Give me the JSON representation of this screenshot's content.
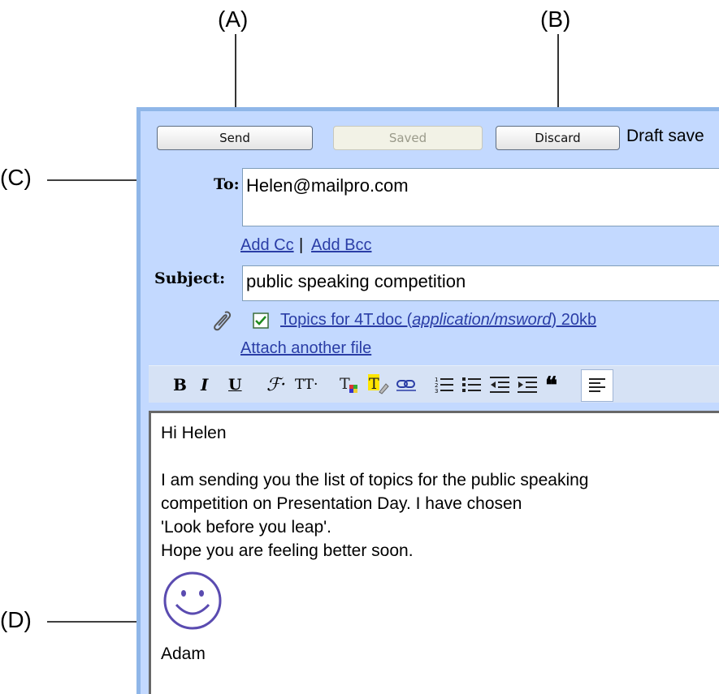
{
  "callouts": {
    "a": "(A)",
    "b": "(B)",
    "c": "(C)",
    "d": "(D)"
  },
  "toolbar": {
    "send_label": "Send",
    "saved_label": "Saved",
    "discard_label": "Discard",
    "draft_status": "Draft save"
  },
  "compose": {
    "to_label": "To:",
    "to_value": "Helen@mailpro.com",
    "add_cc": "Add Cc",
    "separator": "|",
    "add_bcc": "Add Bcc",
    "subject_label": "Subject:",
    "subject_value": "public speaking competition",
    "attachment": {
      "checked": true,
      "name": "Topics for 4T.doc (",
      "type": "application/msword",
      "size": ") 20kb"
    },
    "attach_another": "Attach another file"
  },
  "format_toolbar": {
    "icons": [
      "bold-icon",
      "italic-icon",
      "underline-icon",
      "font-icon",
      "font-size-icon",
      "text-color-icon",
      "highlight-color-icon",
      "link-icon",
      "numbered-list-icon",
      "bulleted-list-icon",
      "outdent-icon",
      "indent-icon",
      "quote-icon",
      "align-left-icon"
    ],
    "bold": "B",
    "italic": "I",
    "underline": "U",
    "font": "ℱ·",
    "font_size": "TT·",
    "text_color": "T"
  },
  "message": {
    "greeting": "Hi Helen",
    "lines": [
      "I am sending you the list of topics for the public speaking",
      "competition on Presentation Day. I have chosen",
      "'Look before you leap'.",
      "Hope you are feeling better soon."
    ],
    "emoticon": "smiley-icon",
    "signature": "Adam"
  },
  "colors": {
    "window_bg": "#c3d9ff",
    "link": "#2a3da6",
    "smiley": "#5a4bb0"
  }
}
